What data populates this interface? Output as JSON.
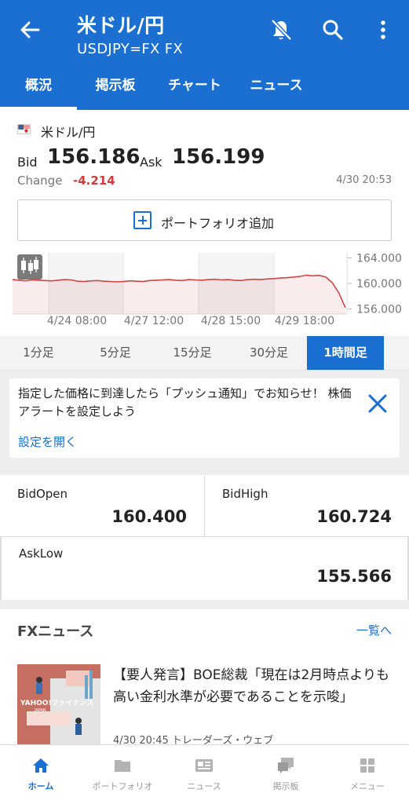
{
  "header": {
    "title": "米ドル/円",
    "subtitle": "USDJPY=FX FX",
    "tabs": [
      {
        "label": "概況",
        "active": true
      },
      {
        "label": "掲示板"
      },
      {
        "label": "チャート"
      },
      {
        "label": "ニュース"
      }
    ],
    "icons": [
      "back-arrow-icon",
      "bell-off-icon",
      "search-icon",
      "more-vert-icon"
    ]
  },
  "quote": {
    "name": "米ドル/円",
    "bid_label": "Bid",
    "bid": "156.186",
    "ask_label": "Ask",
    "ask": "156.199",
    "change_label": "Change",
    "change": "-4.214",
    "timestamp": "4/30 20:53",
    "change_color": "#d23b3b"
  },
  "portfolio_button": {
    "label": "ポートフォリオ追加"
  },
  "chart_data": {
    "type": "line",
    "x_labels": [
      "4/24 08:00",
      "4/27 12:00",
      "4/28 15:00",
      "4/29 18:00"
    ],
    "y_ticks": [
      "164.000",
      "160.000",
      "156.000"
    ],
    "ylim": [
      155.2,
      164.8
    ],
    "grid": true,
    "series": [
      {
        "color": "#d04545",
        "values": [
          160.6,
          160.5,
          160.4,
          160.55,
          160.5,
          160.45,
          160.4,
          160.5,
          160.6,
          160.55,
          160.35,
          160.3,
          160.4,
          160.45,
          160.35,
          160.3,
          160.25,
          160.3,
          160.4,
          160.35,
          160.3,
          160.45,
          160.5,
          160.55,
          160.6,
          160.5,
          160.45,
          160.6,
          160.55,
          160.5,
          160.6,
          160.65,
          160.55,
          160.6,
          160.5,
          160.45,
          160.6,
          160.65,
          160.6,
          160.7,
          160.75,
          160.85,
          160.9,
          161.0,
          161.1,
          161.3,
          161.2,
          161.25,
          161.0,
          160.1,
          158.5,
          156.2
        ]
      }
    ]
  },
  "intervals": [
    {
      "label": "1分足"
    },
    {
      "label": "5分足"
    },
    {
      "label": "15分足"
    },
    {
      "label": "30分足"
    },
    {
      "label": "1時間足",
      "active": true
    }
  ],
  "alert": {
    "text": "指定した価格に到達したら「プッシュ通知」でお知らせ！ 株価アラートを設定しよう",
    "link": "設定を開く"
  },
  "stats": [
    {
      "label": "BidOpen",
      "value": "160.400"
    },
    {
      "label": "BidHigh",
      "value": "160.724"
    },
    {
      "label": "AskLow",
      "value": "155.566"
    }
  ],
  "news": {
    "header": "FXニュース",
    "more": "一覧へ",
    "items": [
      {
        "title": "【要人発言】BOE総裁「現在は2月時点よりも高い金利水準が必要であることを示唆」",
        "meta": "4/30 20:45 トレーダーズ・ウェブ",
        "thumb_text": "YAHOO!ファイナンス",
        "thumb_sub": "JAPAN"
      }
    ]
  },
  "bottom_nav": [
    {
      "label": "ホーム",
      "icon": "home-icon",
      "active": true
    },
    {
      "label": "ポートフォリオ",
      "icon": "folder-icon"
    },
    {
      "label": "ニュース",
      "icon": "news-icon"
    },
    {
      "label": "掲示板",
      "icon": "board-icon"
    },
    {
      "label": "メニュー",
      "icon": "menu-grid-icon"
    }
  ],
  "colors": {
    "primary": "#1a6fd0",
    "negative": "#d23b3b"
  }
}
